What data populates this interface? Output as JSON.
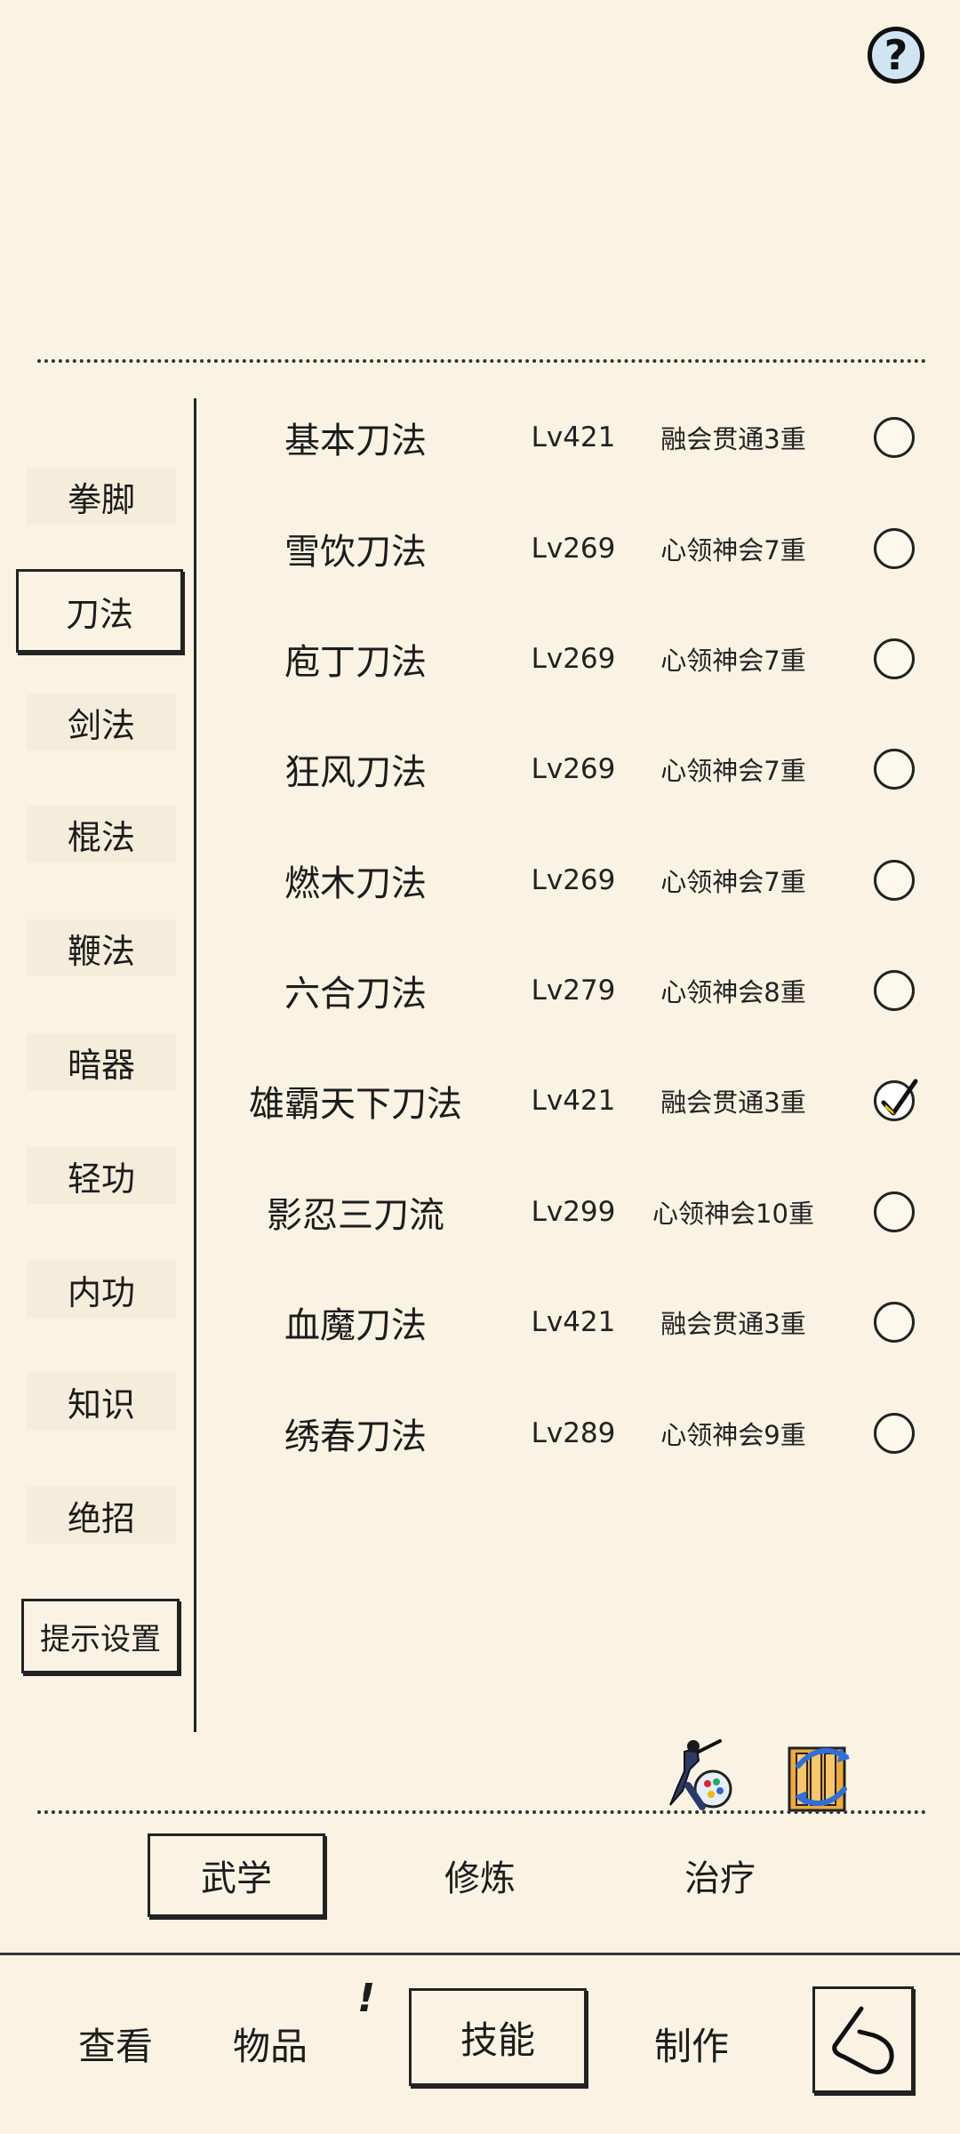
{
  "help": {
    "label": "?"
  },
  "categories": [
    {
      "label": "拳脚",
      "active": false
    },
    {
      "label": "刀法",
      "active": true
    },
    {
      "label": "剑法",
      "active": false
    },
    {
      "label": "棍法",
      "active": false
    },
    {
      "label": "鞭法",
      "active": false
    },
    {
      "label": "暗器",
      "active": false
    },
    {
      "label": "轻功",
      "active": false
    },
    {
      "label": "内功",
      "active": false
    },
    {
      "label": "知识",
      "active": false
    },
    {
      "label": "绝招",
      "active": false
    }
  ],
  "hint_settings_label": "提示设置",
  "skills": [
    {
      "name": "基本刀法",
      "level": "Lv421",
      "realm": "融会贯通3重",
      "checked": false
    },
    {
      "name": "雪饮刀法",
      "level": "Lv269",
      "realm": "心领神会7重",
      "checked": false
    },
    {
      "name": "庖丁刀法",
      "level": "Lv269",
      "realm": "心领神会7重",
      "checked": false
    },
    {
      "name": "狂风刀法",
      "level": "Lv269",
      "realm": "心领神会7重",
      "checked": false
    },
    {
      "name": "燃木刀法",
      "level": "Lv269",
      "realm": "心领神会7重",
      "checked": false
    },
    {
      "name": "六合刀法",
      "level": "Lv279",
      "realm": "心领神会8重",
      "checked": false
    },
    {
      "name": "雄霸天下刀法",
      "level": "Lv421",
      "realm": "融会贯通3重",
      "checked": true
    },
    {
      "name": "影忍三刀流",
      "level": "Lv299",
      "realm": "心领神会10重",
      "checked": false
    },
    {
      "name": "血魔刀法",
      "level": "Lv421",
      "realm": "融会贯通3重",
      "checked": false
    },
    {
      "name": "绣春刀法",
      "level": "Lv289",
      "realm": "心领神会9重",
      "checked": false
    }
  ],
  "art_icons": [
    "swordsman-palette-icon",
    "scroll-swap-icon"
  ],
  "subtabs": [
    {
      "label": "武学",
      "active": true
    },
    {
      "label": "修炼",
      "active": false
    },
    {
      "label": "治疗",
      "active": false
    }
  ],
  "nav": {
    "view": "查看",
    "items": "物品",
    "items_badge": "!",
    "skills": "技能",
    "craft": "制作"
  },
  "colors": {
    "background": "#faf3e3",
    "ink": "#1c1c1c",
    "help_fill": "#cfe6f2"
  }
}
